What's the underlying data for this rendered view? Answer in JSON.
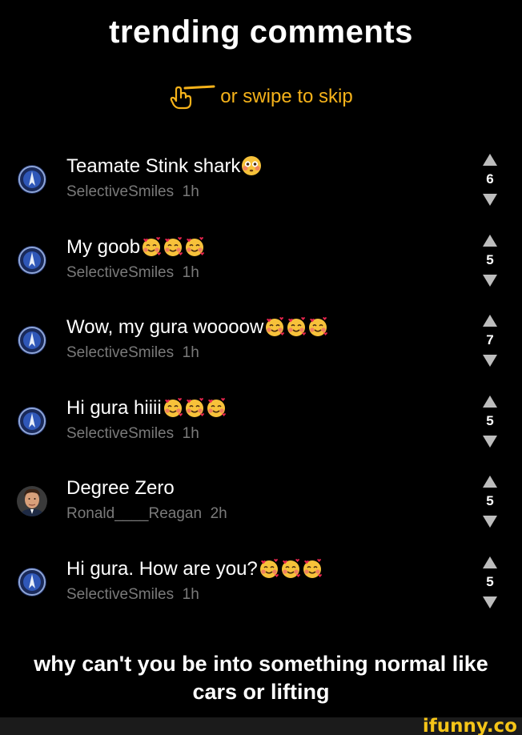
{
  "header": {
    "title": "trending comments",
    "swipe_hint": "or swipe to skip"
  },
  "colors": {
    "background": "#000000",
    "accent": "#f5b21a",
    "meta_text": "#7a7a7a",
    "vote_arrow": "#bdbdbd",
    "brand": "#f5c518"
  },
  "comments": [
    {
      "text": "Teamate Stink shark",
      "emojis": [
        "flushed-face"
      ],
      "user": "SelectiveSmiles",
      "time": "1h",
      "votes": "6",
      "avatar": "badge-avatar"
    },
    {
      "text": "My goob",
      "emojis": [
        "smiling-face-with-hearts",
        "smiling-face-with-hearts",
        "smiling-face-with-hearts"
      ],
      "user": "SelectiveSmiles",
      "time": "1h",
      "votes": "5",
      "avatar": "badge-avatar"
    },
    {
      "text": "Wow, my gura woooow",
      "emojis": [
        "smiling-face-with-hearts",
        "smiling-face-with-hearts",
        "smiling-face-with-hearts"
      ],
      "user": "SelectiveSmiles",
      "time": "1h",
      "votes": "7",
      "avatar": "badge-avatar"
    },
    {
      "text": "Hi gura hiiii",
      "emojis": [
        "smiling-face-with-hearts",
        "smiling-face-with-hearts",
        "smiling-face-with-hearts"
      ],
      "user": "SelectiveSmiles",
      "time": "1h",
      "votes": "5",
      "avatar": "badge-avatar"
    },
    {
      "text": "Degree Zero",
      "emojis": [],
      "user": "Ronald____Reagan",
      "time": "2h",
      "votes": "5",
      "avatar": "portrait-avatar"
    },
    {
      "text": "Hi gura. How are you?",
      "emojis": [
        "smiling-face-with-hearts",
        "smiling-face-with-hearts",
        "smiling-face-with-hearts"
      ],
      "user": "SelectiveSmiles",
      "time": "1h",
      "votes": "5",
      "avatar": "badge-avatar"
    }
  ],
  "caption": {
    "line1": "why can't you be into something normal like",
    "line2": "cars or lifting"
  },
  "footer": {
    "brand": "ifunny.co"
  }
}
